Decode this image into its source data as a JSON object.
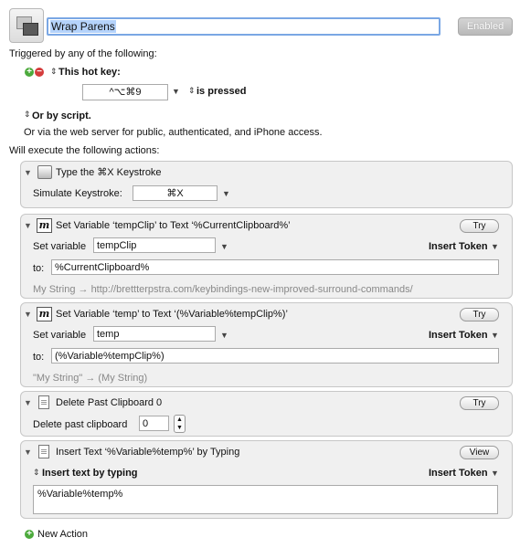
{
  "macro": {
    "name": "Wrap Parens",
    "enabled_label": "Enabled"
  },
  "trigger": {
    "heading": "Triggered by any of the following:",
    "hotkey_label": "This hot key:",
    "hotkey_value": "^⌥⌘9",
    "pressed_label": "is pressed",
    "or_script": "Or by script.",
    "or_web": "Or via the web server for public, authenticated, and iPhone access."
  },
  "actions_heading": "Will execute the following actions:",
  "actions": [
    {
      "title": "Type the ⌘X Keystroke",
      "simulate_label": "Simulate Keystroke:",
      "keystroke": "⌘X"
    },
    {
      "title": "Set Variable ‘tempClip’ to Text ‘%CurrentClipboard%’",
      "try_label": "Try",
      "set_label": "Set variable",
      "variable": "tempClip",
      "insert_token": "Insert Token",
      "to_label": "to:",
      "to_value": "%CurrentClipboard%",
      "preview": "My String → http://brettterpstra.com/keybindings-new-improved-surround-commands/"
    },
    {
      "title": "Set Variable ‘temp’ to Text ‘(%Variable%tempClip%)’",
      "try_label": "Try",
      "set_label": "Set variable",
      "variable": "temp",
      "insert_token": "Insert Token",
      "to_label": "to:",
      "to_value": "(%Variable%tempClip%)",
      "preview": "\"My String\" → (My String)"
    },
    {
      "title": "Delete Past Clipboard 0",
      "try_label": "Try",
      "delete_label": "Delete past clipboard",
      "delete_value": "0"
    },
    {
      "title": "Insert Text ‘%Variable%temp%’ by Typing",
      "view_label": "View",
      "insert_mode": "Insert text by typing",
      "insert_token": "Insert Token",
      "text_value": "%Variable%temp%"
    }
  ],
  "new_action_label": "New Action"
}
